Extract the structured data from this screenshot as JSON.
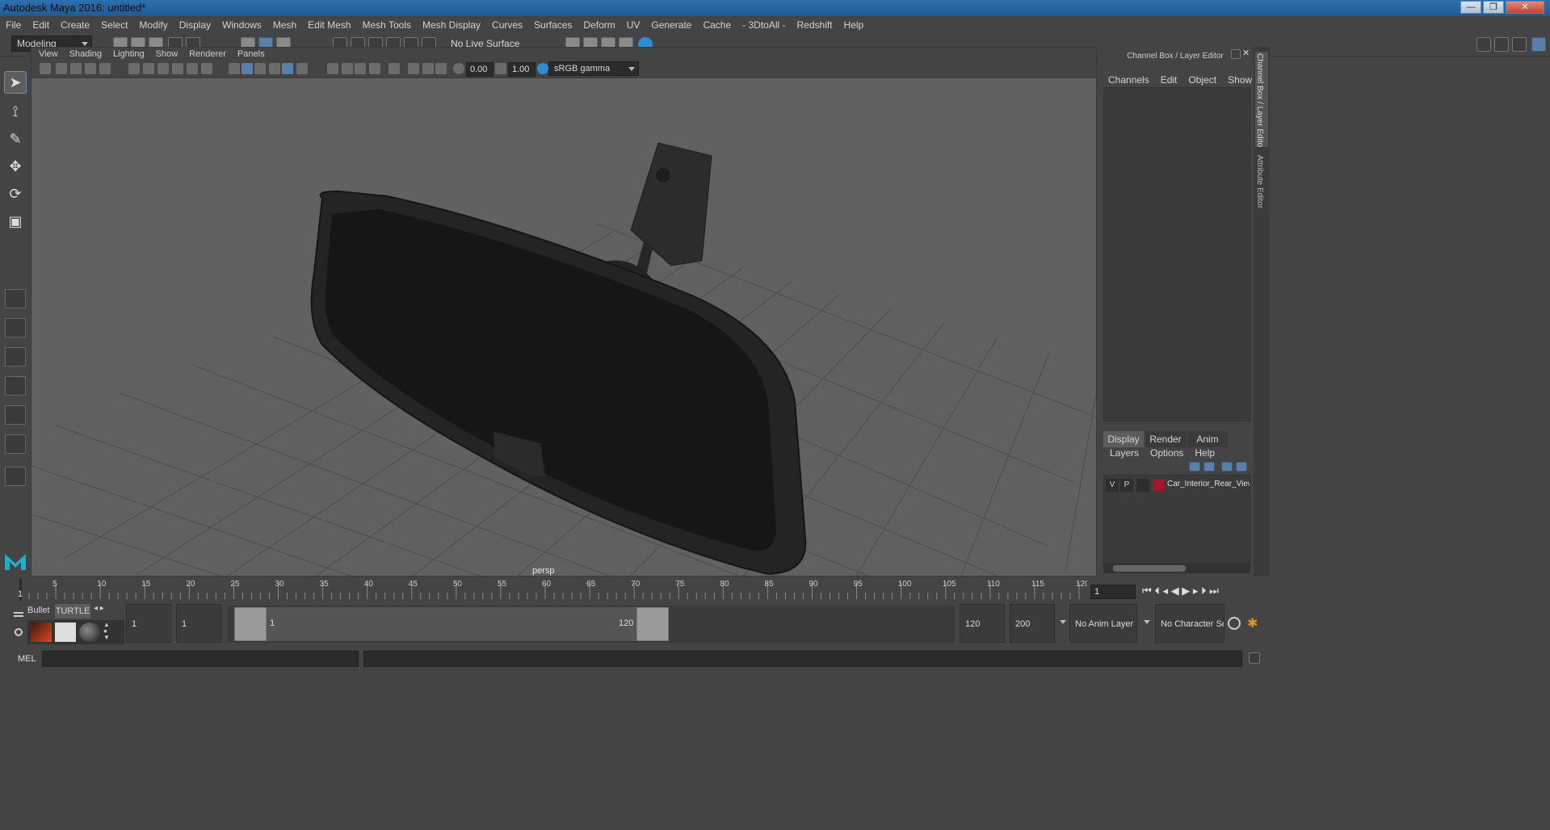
{
  "window": {
    "title": "Autodesk Maya 2016: untitled*",
    "controls": [
      "—",
      "❐",
      "✕"
    ]
  },
  "menubar": {
    "items": [
      "File",
      "Edit",
      "Create",
      "Select",
      "Modify",
      "Display",
      "Windows",
      "Mesh",
      "Edit Mesh",
      "Mesh Tools",
      "Mesh Display",
      "Curves",
      "Surfaces",
      "Deform",
      "UV",
      "Generate",
      "Cache",
      "- 3DtoAll -",
      "Redshift",
      "Help"
    ]
  },
  "shelf": {
    "mode": "Modeling",
    "live_surface": "No Live Surface"
  },
  "panel": {
    "menus": [
      "View",
      "Shading",
      "Lighting",
      "Show",
      "Renderer",
      "Panels"
    ],
    "exposure": "0.00",
    "gamma": "1.00",
    "color_space": "sRGB gamma",
    "camera_label": "persp"
  },
  "channel_box": {
    "title": "Channel Box / Layer Editor",
    "menus": [
      "Channels",
      "Edit",
      "Object",
      "Show"
    ],
    "side_tabs": [
      "Channel Box / Layer Editor",
      "Attribute Editor"
    ]
  },
  "layer_editor": {
    "tabs": [
      "Display",
      "Render",
      "Anim"
    ],
    "active_tab": "Display",
    "menus": [
      "Layers",
      "Options",
      "Help"
    ],
    "layers": [
      {
        "visible": "V",
        "playback": "P",
        "color": "#a0162a",
        "name": "Car_Interior_Rear_View_Mirror"
      }
    ]
  },
  "timeline": {
    "ticks": [
      5,
      10,
      15,
      20,
      25,
      30,
      35,
      40,
      45,
      50,
      55,
      60,
      65,
      70,
      75,
      80,
      85,
      90,
      95,
      100,
      105,
      110,
      115,
      120
    ],
    "start_label": "1",
    "current_frame": "1"
  },
  "range": {
    "shelf_tabs": [
      "Bullet",
      "TURTLE"
    ],
    "start_time": "1",
    "playback_start": "1",
    "slider_start": "1",
    "slider_end": "120",
    "playback_end": "120",
    "end_time": "200",
    "anim_layer": "No Anim Layer",
    "character_set": "No Character Set"
  },
  "command_line": {
    "label": "MEL"
  },
  "colors": {
    "title_bar": "#2f6fae",
    "viewport_bg": "#616161",
    "layer_color": "#a0162a"
  }
}
